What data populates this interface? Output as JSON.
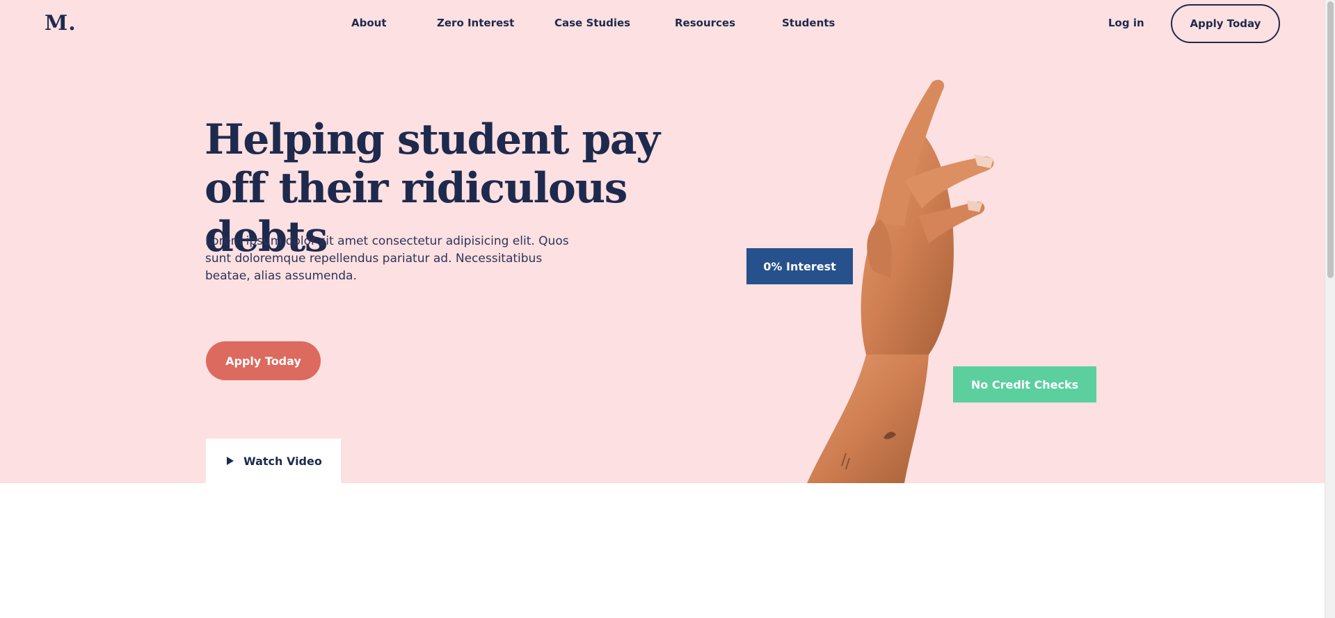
{
  "header": {
    "logo": "M.",
    "nav": [
      {
        "label": "About"
      },
      {
        "label": "Zero Interest"
      },
      {
        "label": "Case Studies"
      },
      {
        "label": "Resources"
      },
      {
        "label": "Students"
      }
    ],
    "login_label": "Log in",
    "apply_label": "Apply Today"
  },
  "hero": {
    "headline_line1": "Helping student pay",
    "headline_line2": "off their ridiculous debts",
    "subtext": "Lorem ipsum dolor sit amet consectetur adipisicing elit. Quos sunt doloremque repellendus pariatur ad. Necessitatibus beatae, alias assumenda.",
    "apply_label": "Apply Today",
    "watch_video_label": "Watch Video",
    "badge_interest": "0% Interest",
    "badge_credit": "No Credit Checks",
    "icons": {
      "play": "play-icon"
    }
  },
  "colors": {
    "hero_background": "#fde0e1",
    "navy": "#1e2a4d",
    "coral": "#dc6a5f",
    "badge_blue": "#27518c",
    "badge_green": "#5ccf9f"
  }
}
